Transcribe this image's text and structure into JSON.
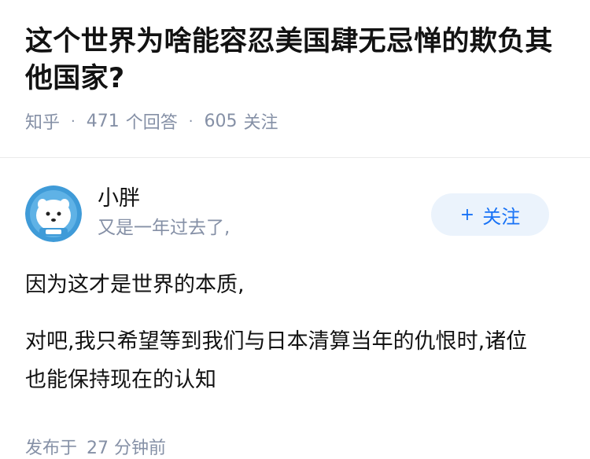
{
  "question": {
    "title": "这个世界为啥能容忍美国肆无忌惮的欺负其他国家?",
    "site": "知乎",
    "answer_count": "471",
    "answer_label": "个回答",
    "follower_count": "605",
    "follower_label": "关注"
  },
  "answer": {
    "author_name": "小胖",
    "author_bio": "又是一年过去了,",
    "follow_button": {
      "icon": "+",
      "label": "关注"
    },
    "paragraphs": [
      "因为这才是世界的本质,",
      "对吧,我只希望等到我们与日本清算当年的仇恨时,诸位也能保持现在的认知"
    ],
    "time_label": "发布于",
    "time_value": "27 分钟前"
  },
  "colors": {
    "accent": "#1772f6",
    "follow_bg": "#ebf3fc",
    "meta_text": "#8590a6",
    "avatar_bg": "#3f9bd8"
  }
}
